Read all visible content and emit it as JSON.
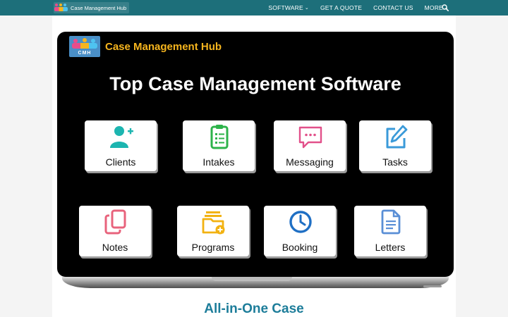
{
  "site": {
    "logo_text": "Case Management Hub"
  },
  "nav": {
    "items": [
      {
        "label": "SOFTWARE",
        "dropdown": true
      },
      {
        "label": "GET A QUOTE",
        "dropdown": false
      },
      {
        "label": "CONTACT US",
        "dropdown": false
      },
      {
        "label": "MORE",
        "dropdown": true
      }
    ],
    "search_icon": "search-icon"
  },
  "hero": {
    "brand_badge": "CMH",
    "brand_name": "Case Management Hub",
    "headline": "Top Case Management Software",
    "modules": [
      {
        "label": "Clients",
        "icon": "user-plus-icon",
        "color": "#1cb5b0"
      },
      {
        "label": "Intakes",
        "icon": "clipboard-icon",
        "color": "#2db34a"
      },
      {
        "label": "Messaging",
        "icon": "chat-icon",
        "color": "#e2508a"
      },
      {
        "label": "Tasks",
        "icon": "edit-icon",
        "color": "#3a9ad9"
      },
      {
        "label": "Notes",
        "icon": "copy-icon",
        "color": "#e8637c"
      },
      {
        "label": "Programs",
        "icon": "folder-plus-icon",
        "color": "#f2b211"
      },
      {
        "label": "Booking",
        "icon": "clock-icon",
        "color": "#1f6fc4"
      },
      {
        "label": "Letters",
        "icon": "document-icon",
        "color": "#5a8fd6"
      }
    ]
  },
  "section": {
    "heading": "All-in-One Case"
  },
  "colors": {
    "nav_bg": "#1d6f7a",
    "brand_accent": "#f6b51e",
    "heading": "#1d7d9a"
  }
}
